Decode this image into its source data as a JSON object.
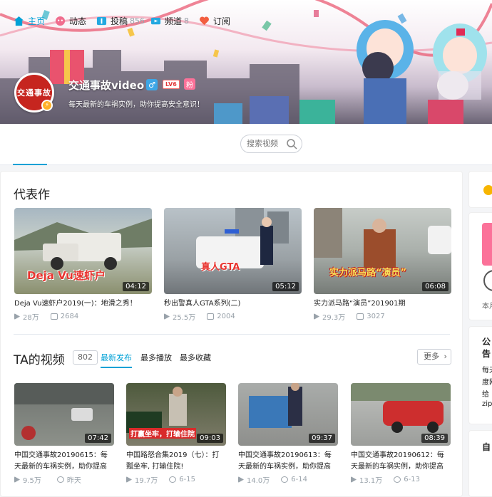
{
  "channel": {
    "name": "交通事故video",
    "avatar_text": "交通事故",
    "level": "LV6",
    "vip_badge": "粉",
    "gender": "♂",
    "sign": "每天最新的车祸实例，助你提高安全意识！"
  },
  "nav": {
    "items": [
      {
        "label": "主页",
        "count": "",
        "icon": "home-icon",
        "active": true
      },
      {
        "label": "动态",
        "count": "",
        "icon": "dynamic-icon",
        "active": false
      },
      {
        "label": "投稿",
        "count": "856",
        "icon": "upload-icon",
        "active": false
      },
      {
        "label": "频道",
        "count": "8",
        "icon": "channel-icon",
        "active": false
      },
      {
        "label": "订阅",
        "count": "",
        "icon": "heart-icon",
        "active": false
      }
    ],
    "search_placeholder": "搜索视频"
  },
  "featured": {
    "title": "代表作",
    "cards": [
      {
        "title": "Deja Vu速虾户2019(一)：地滑之秀！",
        "views": "28万",
        "danmaku": "2684",
        "duration": "04:12",
        "overlay": "Deja Vu速虾户"
      },
      {
        "title": "秒出警真人GTA系列(二)",
        "views": "25.5万",
        "danmaku": "2004",
        "duration": "05:12",
        "overlay": "真人GTA"
      },
      {
        "title": "实力派马路“演员”201901期",
        "views": "29.3万",
        "danmaku": "3027",
        "duration": "06:08",
        "overlay": "实力派马路“演员”"
      }
    ]
  },
  "videos": {
    "title": "TA的视频",
    "count": "802",
    "tabs": [
      "最新发布",
      "最多播放",
      "最多收藏"
    ],
    "more_label": "更多",
    "cards": [
      {
        "title": "中国交通事故20190615：每天最新的车祸实例，助你提高",
        "views": "9.5万",
        "date": "昨天",
        "duration": "07:42",
        "overlay": ""
      },
      {
        "title": "中国路怒合集2019（七）：打瓢坐牢, 打输住院!",
        "views": "19.7万",
        "date": "6-15",
        "duration": "09:03",
        "overlay": "打赢坐牢，打输住院"
      },
      {
        "title": "中国交通事故20190613：每天最新的车祸实例，助你提高",
        "views": "14.0万",
        "date": "6-14",
        "duration": "09:37",
        "overlay": ""
      },
      {
        "title": "中国交通事故20190612：每天最新的车祸实例，助你提高",
        "views": "13.1万",
        "date": "6-13",
        "duration": "08:39",
        "overlay": ""
      }
    ]
  },
  "sidebar": {
    "announcement_title": "公告",
    "announcement_lines": [
      "每天",
      "度网",
      "给",
      "zip"
    ],
    "section2_title": "自",
    "small_label": "本月"
  },
  "colors": {
    "accent": "#00a1d6",
    "pink": "#fb7299",
    "red_banner": "#c6251f"
  }
}
